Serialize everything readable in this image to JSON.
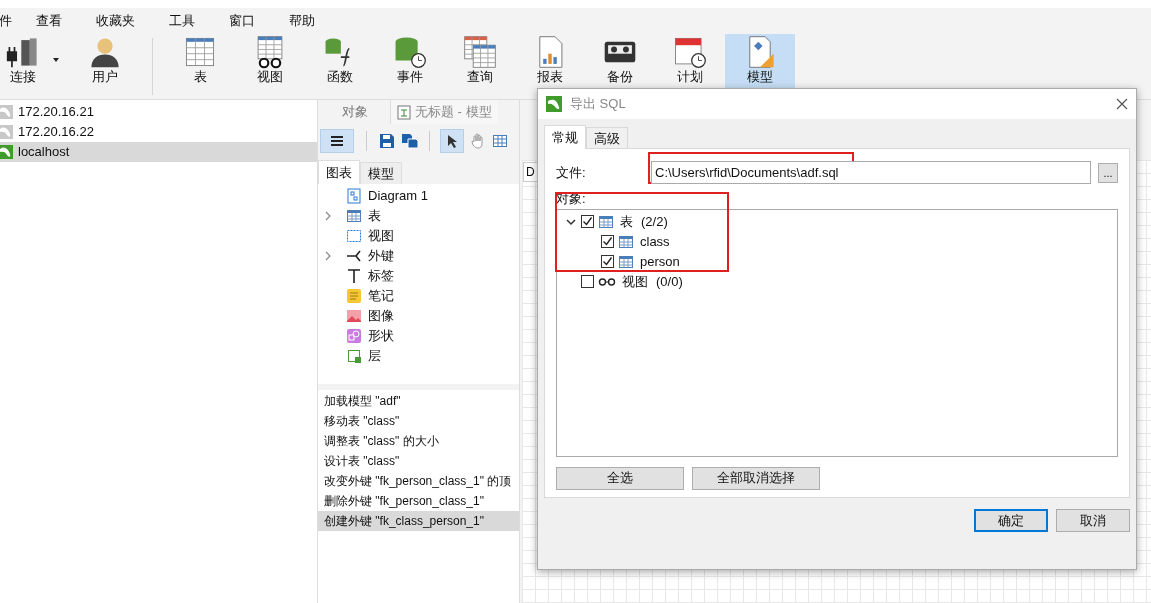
{
  "menu": [
    "件",
    "查看",
    "收藏夹",
    "工具",
    "窗口",
    "帮助"
  ],
  "toolbar": [
    {
      "label": "连接",
      "kind": "connect",
      "selected": false
    },
    {
      "label": "用户",
      "kind": "user",
      "selected": false
    },
    {
      "label": "表",
      "kind": "table",
      "selected": false
    },
    {
      "label": "视图",
      "kind": "view",
      "selected": false
    },
    {
      "label": "函数",
      "kind": "function",
      "selected": false
    },
    {
      "label": "事件",
      "kind": "event",
      "selected": false
    },
    {
      "label": "查询",
      "kind": "query",
      "selected": false
    },
    {
      "label": "报表",
      "kind": "report",
      "selected": false
    },
    {
      "label": "备份",
      "kind": "backup",
      "selected": false
    },
    {
      "label": "计划",
      "kind": "schedule",
      "selected": false
    },
    {
      "label": "模型",
      "kind": "model",
      "selected": true
    }
  ],
  "connections": [
    {
      "label": "172.20.16.21",
      "connected": false,
      "selected": false
    },
    {
      "label": "172.20.16.22",
      "connected": false,
      "selected": false
    },
    {
      "label": "localhost",
      "connected": true,
      "selected": true
    }
  ],
  "object_tabs": [
    {
      "label": "对象",
      "selected": false
    },
    {
      "label": "无标题 - 模型",
      "selected": true
    }
  ],
  "side_tabs": [
    {
      "label": "图表",
      "selected": true
    },
    {
      "label": "模型",
      "selected": false
    }
  ],
  "palette": [
    {
      "label": "Diagram 1",
      "kind": "diagram",
      "expandable": false
    },
    {
      "label": "表",
      "kind": "table",
      "expandable": true
    },
    {
      "label": "视图",
      "kind": "view",
      "expandable": false
    },
    {
      "label": "外键",
      "kind": "fk",
      "expandable": true
    },
    {
      "label": "标签",
      "kind": "label",
      "expandable": false
    },
    {
      "label": "笔记",
      "kind": "note",
      "expandable": false
    },
    {
      "label": "图像",
      "kind": "image",
      "expandable": false
    },
    {
      "label": "形状",
      "kind": "shape",
      "expandable": false
    },
    {
      "label": "层",
      "kind": "layer",
      "expandable": false
    }
  ],
  "history": [
    {
      "text": "加载模型 \"adf\"",
      "selected": false
    },
    {
      "text": "移动表 \"class\"",
      "selected": false
    },
    {
      "text": "调整表 \"class\" 的大小",
      "selected": false
    },
    {
      "text": "设计表 \"class\"",
      "selected": false
    },
    {
      "text": "改变外键 \"fk_person_class_1\" 的顶",
      "selected": false
    },
    {
      "text": "删除外键 \"fk_person_class_1\"",
      "selected": false
    },
    {
      "text": "创建外键 \"fk_class_person_1\"",
      "selected": true
    }
  ],
  "canvas_tab": "D",
  "dialog": {
    "title": "导出 SQL",
    "tabs": [
      {
        "label": "常规",
        "selected": true
      },
      {
        "label": "高级",
        "selected": false
      }
    ],
    "file_label": "文件:",
    "file_value": "C:\\Users\\rfid\\Documents\\adf.sql",
    "browse": "...",
    "objects_label": "对象:",
    "tree": [
      {
        "label": "表",
        "count": "(2/2)",
        "kind": "table",
        "checked": true,
        "expanded": true,
        "children": [
          {
            "label": "class",
            "kind": "table",
            "checked": true
          },
          {
            "label": "person",
            "kind": "table",
            "checked": true
          }
        ]
      },
      {
        "label": "视图",
        "count": "(0/0)",
        "kind": "view",
        "checked": false
      }
    ],
    "select_all": "全选",
    "deselect_all": "全部取消选择",
    "ok": "确定",
    "cancel": "取消"
  }
}
